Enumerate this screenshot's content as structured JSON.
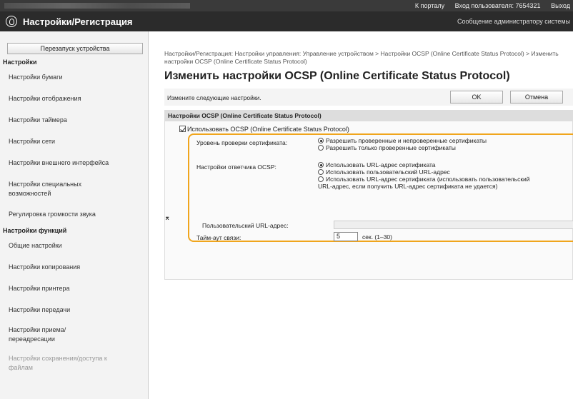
{
  "topbar": {
    "portal_link": "К порталу",
    "login_user": "Вход пользователя: 7654321",
    "logout": "Выход"
  },
  "header": {
    "title": "Настройки/Регистрация",
    "admin_message": "Сообщение администратору системы"
  },
  "sidebar": {
    "restart_button": "Перезапуск устройства",
    "settings_heading": "Настройки",
    "settings_items": [
      "Настройки бумаги",
      "Настройки отображения",
      "Настройки таймера",
      "Настройки сети",
      "Настройки внешнего интерфейса",
      "Настройки специальных возможностей",
      "Регулировка громкости звука"
    ],
    "functions_heading": "Настройки функций",
    "functions_items": [
      "Общие настройки",
      "Настройки копирования",
      "Настройки принтера",
      "Настройки передачи",
      "Настройки приема/переадресации",
      "Настройки сохранения/доступа к файлам"
    ]
  },
  "main": {
    "breadcrumb": "Настройки/Регистрация: Настройки управления: Управление устройством > Настройки OCSP (Online Certificate Status Protocol) > Изменить настройки OCSP (Online Certificate Status Protocol)",
    "title": "Изменить настройки OCSP (Online Certificate Status Protocol)",
    "description": "Измените следующие настройки.",
    "ok_button": "OK",
    "cancel_button": "Отмена",
    "section_title": "Настройки OCSP (Online Certificate Status Protocol)",
    "use_ocsp_label": "Использовать OCSP (Online Certificate Status Protocol)",
    "use_ocsp_checked": true,
    "cert_level_label": "Уровень проверки сертификата:",
    "cert_level_options": [
      "Разрешить проверенные и непроверенные сертификаты",
      "Разрешить только проверенные сертификаты"
    ],
    "cert_level_selected": 0,
    "responder_label": "Настройки ответчика OCSP:",
    "responder_options": [
      "Использовать URL-адрес сертификата",
      "Использовать пользовательский URL-адрес",
      "Использовать URL-адрес сертификата (использовать пользовательский",
      "URL-адрес, если получить URL-адрес сертификата не удается)"
    ],
    "responder_selected": 0,
    "custom_url_label": "Пользовательский URL-адрес:",
    "custom_url_value": "",
    "timeout_label": "Тайм-аут связи:",
    "timeout_value": "5",
    "timeout_unit": "сек. (1–30)",
    "to_top": "⌅"
  },
  "colors": {
    "highlight": "#f0a51c",
    "header_bg": "#2b2b2b"
  }
}
